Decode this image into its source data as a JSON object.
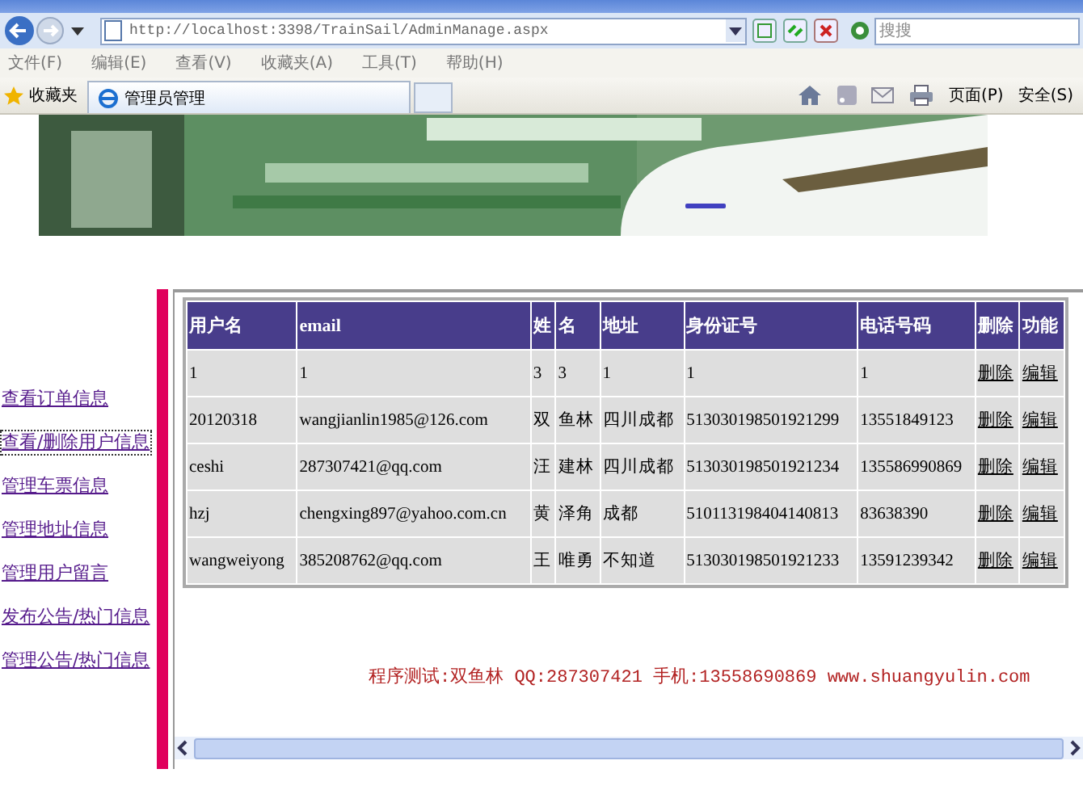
{
  "browser": {
    "address": "http://localhost:3398/TrainSail/AdminManage.aspx",
    "search_placeholder": "搜搜",
    "menu": [
      "文件(F)",
      "编辑(E)",
      "查看(V)",
      "收藏夹(A)",
      "工具(T)",
      "帮助(H)"
    ],
    "favorites": "收藏夹",
    "tab": {
      "label": "管理员管理",
      "selected": true
    },
    "commands": [
      "页面(P)",
      "安全(S)"
    ]
  },
  "sidebar": {
    "items": [
      {
        "label": "查看订单信息",
        "selected": false
      },
      {
        "label": "查看/删除用户信息",
        "selected": true
      },
      {
        "label": "管理车票信息",
        "selected": false
      },
      {
        "label": "管理地址信息",
        "selected": false
      },
      {
        "label": "管理用户留言",
        "selected": false
      },
      {
        "label": "发布公告/热门信息",
        "selected": false
      },
      {
        "label": "管理公告/热门信息",
        "selected": false
      }
    ]
  },
  "table": {
    "columns": [
      "用户名",
      "email",
      "姓",
      "名",
      "地址",
      "身份证号",
      "电话号码",
      "删除",
      "功能"
    ],
    "rows": [
      [
        "1",
        "1",
        "3",
        "3",
        "1",
        "1",
        "1",
        "删除",
        "编辑"
      ],
      [
        "20120318",
        "wangjianlin1985@126.com",
        "双",
        "鱼林",
        "四川成都",
        "513030198501921299",
        "13551849123",
        "删除",
        "编辑"
      ],
      [
        "ceshi",
        "287307421@qq.com",
        "汪",
        "建林",
        "四川成都",
        "513030198501921234",
        "135586990869",
        "删除",
        "编辑"
      ],
      [
        "hzj",
        "chengxing897@yahoo.com.cn",
        "黄",
        "泽角",
        "成都",
        "510113198404140813",
        "83638390",
        "删除",
        "编辑"
      ],
      [
        "wangweiyong",
        "385208762@qq.com",
        "王",
        "唯勇",
        "不知道",
        "513030198501921233",
        "13591239342",
        "删除",
        "编辑"
      ]
    ]
  },
  "footer": "程序测试:双鱼林 QQ:287307421 手机:13558690869 www.shuangyulin.com"
}
